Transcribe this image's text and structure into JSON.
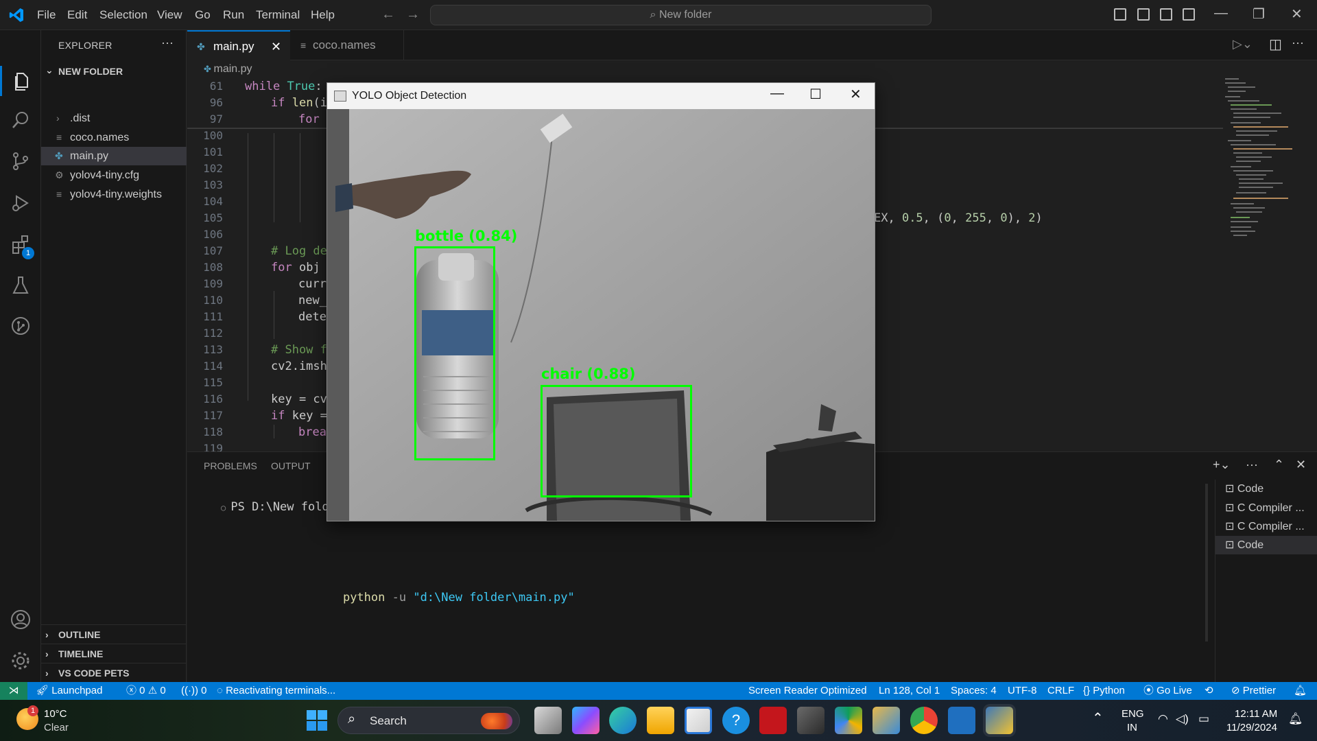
{
  "menu": [
    "File",
    "Edit",
    "Selection",
    "View",
    "Go",
    "Run",
    "Terminal",
    "Help"
  ],
  "command_center": {
    "text": "New folder"
  },
  "sidebar": {
    "title": "EXPLORER",
    "folder": "NEW FOLDER",
    "items": [
      {
        "label": ".dist",
        "icon": "chevron-right-icon"
      },
      {
        "label": "coco.names",
        "icon": "file-lines-icon"
      },
      {
        "label": "main.py",
        "icon": "python-icon",
        "selected": true
      },
      {
        "label": "yolov4-tiny.cfg",
        "icon": "gear-icon"
      },
      {
        "label": "yolov4-tiny.weights",
        "icon": "file-lines-icon"
      }
    ],
    "sections": [
      "OUTLINE",
      "TIMELINE",
      "VS CODE PETS"
    ]
  },
  "activity_badge": "1",
  "tabs": [
    {
      "label": "main.py",
      "active": true
    },
    {
      "label": "coco.names",
      "active": false
    }
  ],
  "breadcrumb": "main.py",
  "code": {
    "line_numbers": [
      "61",
      "96",
      "97",
      "100",
      "101",
      "102",
      "103",
      "104",
      "105",
      "106",
      "107",
      "108",
      "109",
      "110",
      "111",
      "112",
      "113",
      "114",
      "115",
      "116",
      "117",
      "118",
      "119"
    ],
    "visible_fragments": {
      "l61_kw": "while",
      "l61_bi": "True",
      "l61_tx": ":",
      "l96_kw": "if",
      "l96_fn": "len",
      "l96_tx": "(i",
      "l97_kw": "for",
      "l97_tx": " i",
      "l105_tail_a": "EX, ",
      "l105_tail_n1": "0.5",
      "l105_tail_b": ", (",
      "l105_tail_n2": "0",
      "l105_tail_c": ", ",
      "l105_tail_n3": "255",
      "l105_tail_d": ", ",
      "l105_tail_n4": "0",
      "l105_tail_e": "), ",
      "l105_tail_n5": "2",
      "l105_tail_f": ")",
      "l107": "# Log de",
      "l108_kw": "for",
      "l108_tx": " obj",
      "l109": "curre",
      "l110": "new_",
      "l111": "dete",
      "l113": "# Show f",
      "l114": "cv2.imsh",
      "l116": "key = cv",
      "l117_kw": "if",
      "l117_tx": " key =",
      "l118_kw": "brea"
    }
  },
  "panel": {
    "tabs": [
      "PROBLEMS",
      "OUTPUT"
    ],
    "prompt": "PS D:\\New folder> ",
    "prompt_tail": "py",
    "cmd_python": "python",
    "cmd_flag": " -u ",
    "cmd_path": "\"d:\\New folder\\main.py\"",
    "terminals": [
      "Code",
      "C Compiler ...",
      "C Compiler ...",
      "Code"
    ]
  },
  "yolo_window": {
    "title": "YOLO Object Detection",
    "detections": [
      {
        "label": "bottle (0.84)",
        "class": "bottle",
        "confidence": 0.84
      },
      {
        "label": "chair (0.88)",
        "class": "chair",
        "confidence": 0.88
      }
    ]
  },
  "statusbar": {
    "launchpad": "Launchpad",
    "errors": "0",
    "warnings": "0",
    "ports": "0",
    "reactivating": "Reactivating terminals...",
    "screen_reader": "Screen Reader Optimized",
    "position": "Ln 128, Col 1",
    "spaces": "Spaces: 4",
    "encoding": "UTF-8",
    "eol": "CRLF",
    "language": "Python",
    "golive": "Go Live",
    "prettier": "Prettier"
  },
  "taskbar": {
    "weather_temp": "10°C",
    "weather_desc": "Clear",
    "weather_badge": "1",
    "search": "Search",
    "lang_top": "ENG",
    "lang_bottom": "IN",
    "time": "12:11 AM",
    "date": "11/29/2024"
  },
  "colors": {
    "accent": "#0078d4",
    "detection": "#00ff00",
    "remote": "#16825d"
  }
}
